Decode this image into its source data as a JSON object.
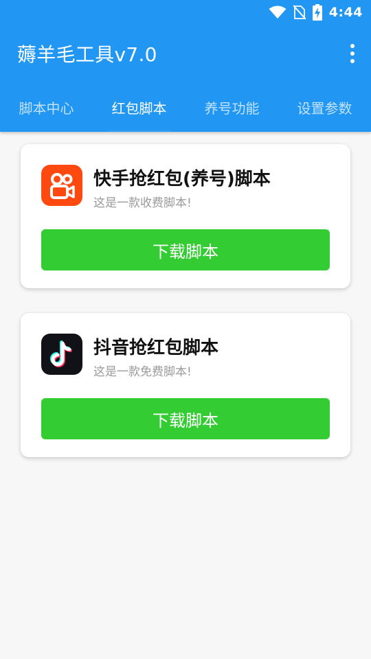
{
  "status_bar": {
    "time": "4:44",
    "icons": [
      "wifi-icon",
      "no-sim-icon",
      "battery-charging-icon"
    ]
  },
  "app_bar": {
    "title": "薅羊毛工具v7.0",
    "menu_icon": "more-vert-icon"
  },
  "tabs": [
    {
      "label": "脚本中心",
      "active": false
    },
    {
      "label": "红包脚本",
      "active": true
    },
    {
      "label": "养号功能",
      "active": false
    },
    {
      "label": "设置参数",
      "active": false
    }
  ],
  "cards": [
    {
      "title": "快手抢红包(养号)脚本",
      "description": "这是一款收费脚本!",
      "button_label": "下载脚本",
      "icon": "kuaishou-icon"
    },
    {
      "title": "抖音抢红包脚本",
      "description": "这是一款免费脚本!",
      "button_label": "下载脚本",
      "icon": "douyin-icon"
    }
  ],
  "colors": {
    "primary": "#2196f3",
    "button": "#33cc33",
    "kuaishou": "#fe4a10",
    "douyin": "#111118"
  }
}
